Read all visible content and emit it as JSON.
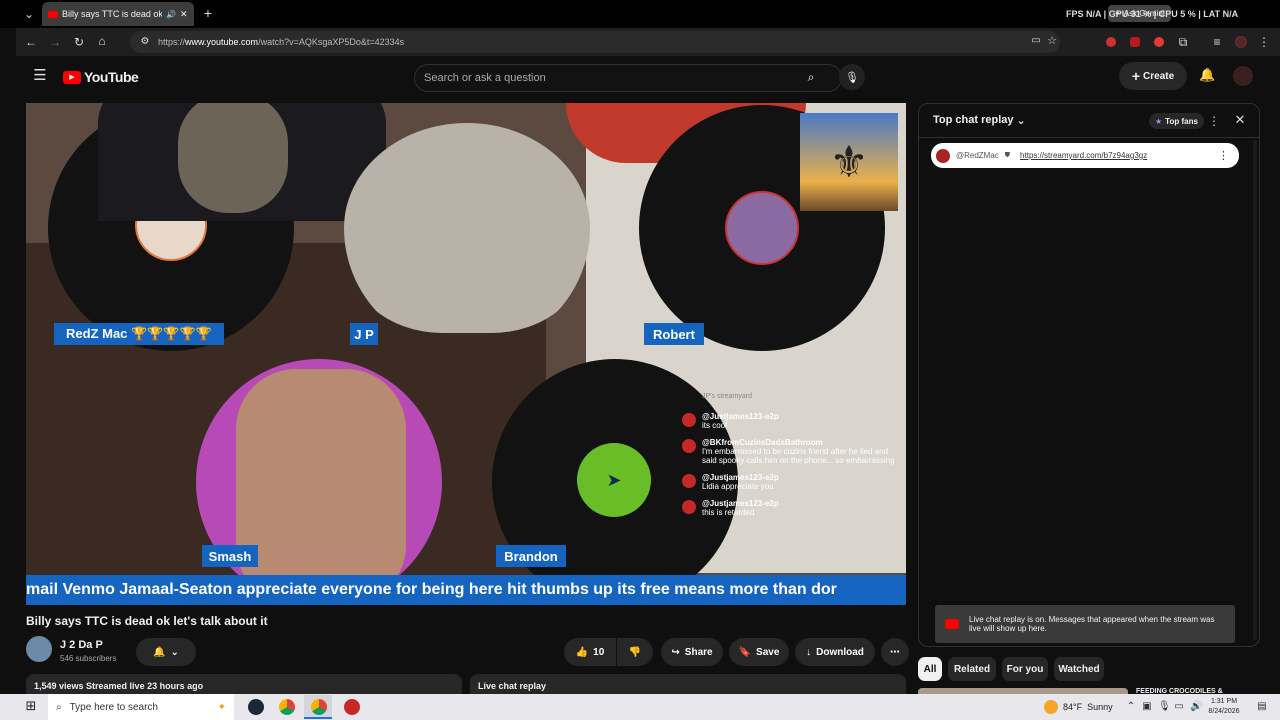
{
  "browser": {
    "tab_title": "Billy says TTC is dead ok let's talk about it",
    "tab_close": "✕",
    "new_tab": "+",
    "url_prefix": "https://",
    "url_domain": "www.youtube.com",
    "url_rest": "/watch?v=AQKsgaXP5Do&t=42334s",
    "overlay_stats": "FPS N/A | GPU 31 % | CPU 5 % | LAT N/A",
    "ask_gemini": "Ask Gemini"
  },
  "youtube": {
    "logo": "YouTube",
    "search_placeholder": "Search or ask a question",
    "create_label": "Create"
  },
  "video": {
    "participants": [
      {
        "name": "RedZ Mac 🏆🏆🏆🏆🏆"
      },
      {
        "name": "J P"
      },
      {
        "name": "Robert"
      },
      {
        "name": "Smash"
      },
      {
        "name": "Brandon"
      }
    ],
    "ticker": "mail Venmo Jamaal-Seaton appreciate everyone for being here hit thumbs up its free means more than dor",
    "overlay_chat_header": "JP's streamyard",
    "overlay_chat": [
      {
        "user": "@Justjames123-e2p",
        "text": "its cool"
      },
      {
        "user": "@BKfromCuzinsDadsBathroom",
        "text": "I'm embarrassed to be cuzins friend after he lied and said spooky calls him on the phone... so embarrassing"
      },
      {
        "user": "@Justjames123-e2p",
        "text": "Lidia appreciate you"
      },
      {
        "user": "@Justjames123-e2p",
        "text": "this is retarded"
      }
    ]
  },
  "meta": {
    "title": "Billy says TTC is dead ok let's talk about it",
    "channel": "J 2 Da P",
    "subscribers": "546 subscribers",
    "likes": "10",
    "share": "Share",
    "save": "Save",
    "download": "Download",
    "views_line": "1,549 views  Streamed live 23 hours ago",
    "live_chat_replay": "Live chat replay"
  },
  "chat": {
    "title": "Top chat replay",
    "top_fans": "Top fans",
    "pinned_user": "@RedZMac",
    "pinned_link": "https://streamyard.com/b7z94ag3gz",
    "notice": "Live chat replay is on. Messages that appeared when the stream was live will show up here."
  },
  "chips": [
    "All",
    "Related",
    "For you",
    "Watched"
  ],
  "recommended_peek": "FEEDING CROCODILES &",
  "taskbar": {
    "search_placeholder": "Type here to search",
    "weather": "84°F  Sunny",
    "time": "1:31 PM",
    "date": "8/24/2026"
  },
  "colors": {
    "accent": "#1565c0",
    "yt_red": "#ff0000",
    "seahawks_green": "#69be28"
  }
}
